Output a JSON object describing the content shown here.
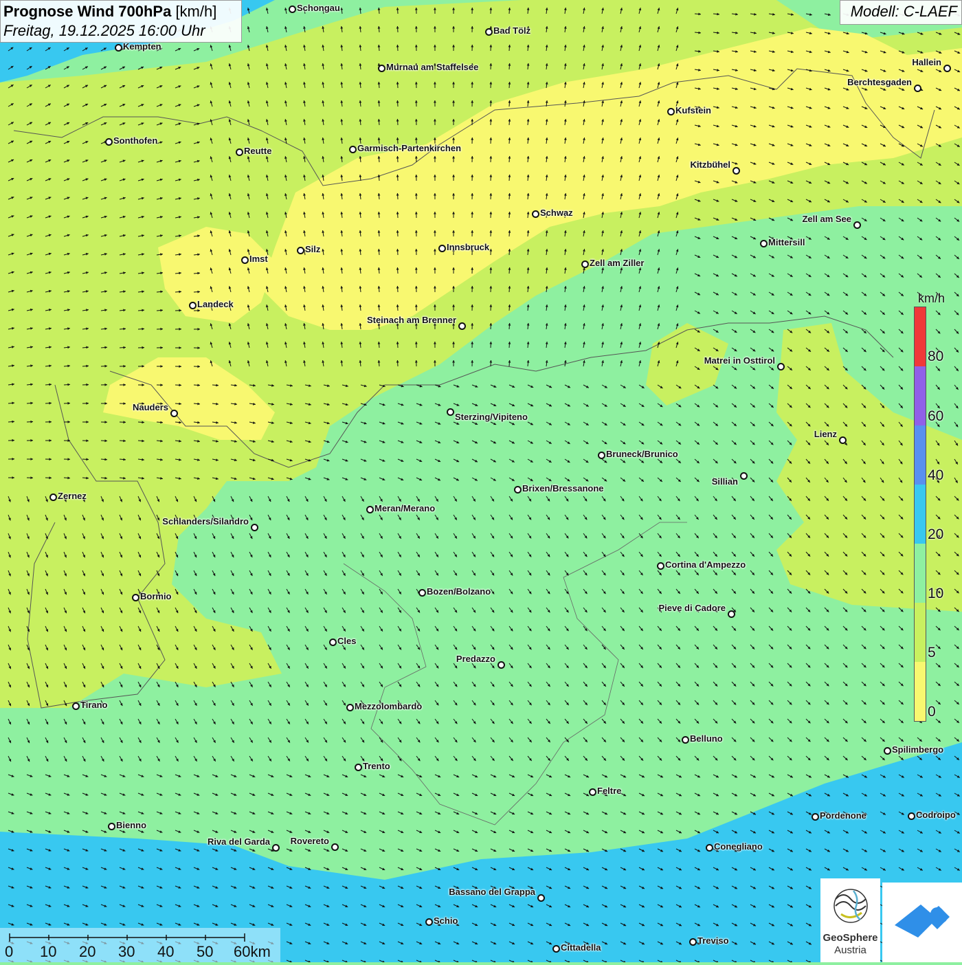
{
  "title": {
    "main": "Prognose Wind 700hPa",
    "unit": "[km/h]",
    "datetime": "Freitag, 19.12.2025 16:00 Uhr"
  },
  "model": "Modell: C-LAEF",
  "legend": {
    "unit": "km/h",
    "labels": [
      "80",
      "60",
      "40",
      "20",
      "10",
      "5",
      "0"
    ],
    "colors": {
      "0-5": "#f8f870",
      "5-10": "#c8f060",
      "10-20": "#8ef0a0",
      "20-40": "#38c8f0",
      "40-60": "#5890f0",
      "60-80": "#9060e8",
      "80+": "#f03838"
    }
  },
  "scale": {
    "labels": [
      "0",
      "10",
      "20",
      "30",
      "40",
      "50",
      "60km"
    ]
  },
  "logo": {
    "name": "GeoSphere",
    "sub": "Austria"
  },
  "cities": [
    {
      "name": "Schongau"
    },
    {
      "name": "Bad Tölz"
    },
    {
      "name": "Kempten"
    },
    {
      "name": "Murnau am Staffelsee"
    },
    {
      "name": "Hallein"
    },
    {
      "name": "Berchtesgaden"
    },
    {
      "name": "Kufstein"
    },
    {
      "name": "Sonthofen"
    },
    {
      "name": "Reutte"
    },
    {
      "name": "Garmisch-Partenkirchen"
    },
    {
      "name": "Kitzbühel"
    },
    {
      "name": "Schwaz"
    },
    {
      "name": "Zell am See"
    },
    {
      "name": "Mittersill"
    },
    {
      "name": "Innsbruck"
    },
    {
      "name": "Silz"
    },
    {
      "name": "Imst"
    },
    {
      "name": "Zell am Ziller"
    },
    {
      "name": "Landeck"
    },
    {
      "name": "Steinach am Brenner"
    },
    {
      "name": "Matrei in Osttirol"
    },
    {
      "name": "Nauders"
    },
    {
      "name": "Sterzing/Vipiteno"
    },
    {
      "name": "Lienz"
    },
    {
      "name": "Bruneck/Brunico"
    },
    {
      "name": "Sillian"
    },
    {
      "name": "Zernez"
    },
    {
      "name": "Brixen/Bressanone"
    },
    {
      "name": "Meran/Merano"
    },
    {
      "name": "Schlanders/Silandro"
    },
    {
      "name": "Cortina d'Ampezzo"
    },
    {
      "name": "Bozen/Bolzano"
    },
    {
      "name": "Bormio"
    },
    {
      "name": "Pieve di Cadore"
    },
    {
      "name": "Cles"
    },
    {
      "name": "Predazzo"
    },
    {
      "name": "Tirano"
    },
    {
      "name": "Mezzolombardo"
    },
    {
      "name": "Belluno"
    },
    {
      "name": "Spilimbergo"
    },
    {
      "name": "Trento"
    },
    {
      "name": "Feltre"
    },
    {
      "name": "Pordenone"
    },
    {
      "name": "Codroipo"
    },
    {
      "name": "Bienno"
    },
    {
      "name": "Riva del Garda"
    },
    {
      "name": "Rovereto"
    },
    {
      "name": "Conegliano"
    },
    {
      "name": "Bassano del Grappa"
    },
    {
      "name": "Schio"
    },
    {
      "name": "Treviso"
    },
    {
      "name": "Cittadella"
    }
  ]
}
